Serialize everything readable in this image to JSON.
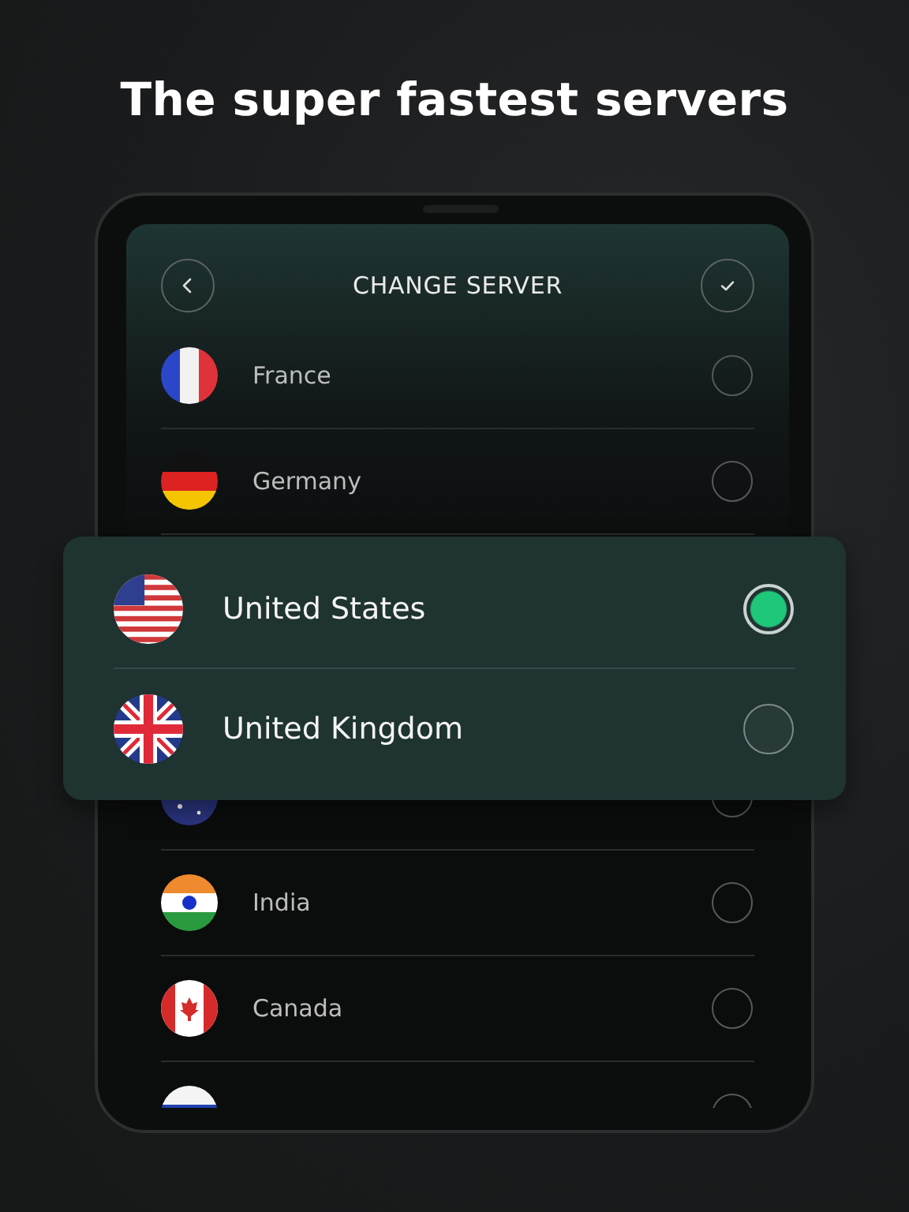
{
  "headline": "The super fastest servers",
  "header": {
    "title": "CHANGE SERVER"
  },
  "servers": [
    {
      "name": "France",
      "kind": "fr",
      "selected": false
    },
    {
      "name": "Germany",
      "kind": "de",
      "selected": false
    },
    {
      "kind": "au",
      "selected": false
    },
    {
      "name": "India",
      "kind": "in",
      "selected": false
    },
    {
      "name": "Canada",
      "kind": "ca",
      "selected": false
    },
    {
      "kind": "ru",
      "selected": false
    }
  ],
  "popup": {
    "servers": [
      {
        "name": "United States",
        "kind": "us",
        "selected": true
      },
      {
        "name": "United Kingdom",
        "kind": "gb",
        "selected": false
      }
    ]
  }
}
